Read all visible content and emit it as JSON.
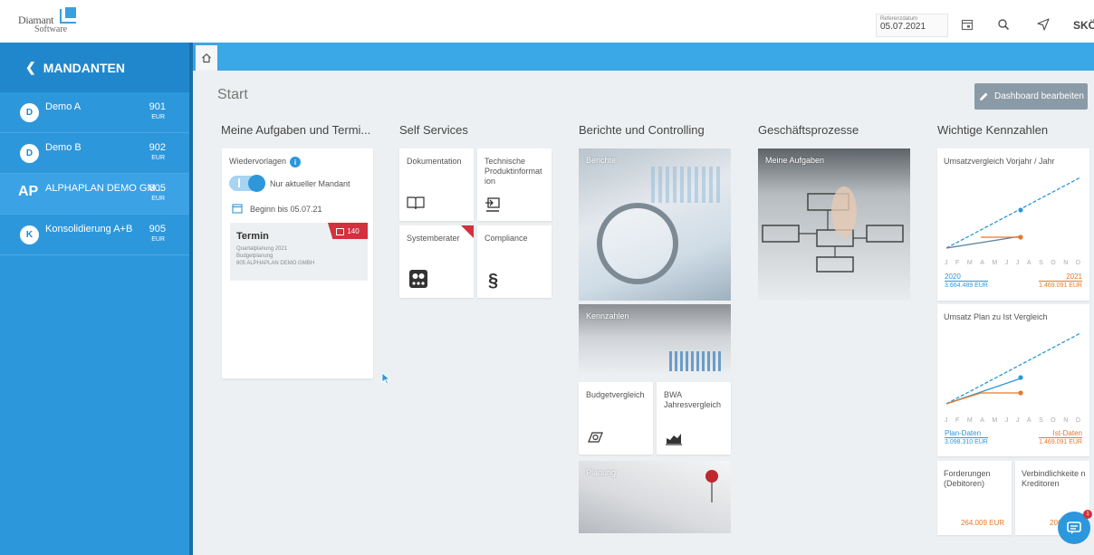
{
  "brand": {
    "line1": "Diamant",
    "line2": "Software"
  },
  "topbar": {
    "refdate_label": "Referenzdatum",
    "refdate_value": "05.07.2021",
    "user": "SKÖ"
  },
  "sidebar": {
    "header": "MANDANTEN",
    "items": [
      {
        "avatar": "D",
        "name": "Demo A",
        "number": "901",
        "currency": "EUR"
      },
      {
        "avatar": "D",
        "name": "Demo B",
        "number": "902",
        "currency": "EUR"
      },
      {
        "avatar": "AP",
        "name": "ALPHAPLAN DEMO GM...",
        "number": "805",
        "currency": "EUR"
      },
      {
        "avatar": "K",
        "name": "Konsolidierung A+B",
        "number": "905",
        "currency": "EUR"
      }
    ]
  },
  "main": {
    "title": "Start",
    "edit_button": "Dashboard bearbeiten",
    "columns": {
      "aufgaben": "Meine Aufgaben und Termi...",
      "self_services": "Self Services",
      "berichte": "Berichte und Controlling",
      "prozesse": "Geschäftsprozesse",
      "kennzahlen": "Wichtige Kennzahlen"
    }
  },
  "aufgaben": {
    "wiedervorlagen": "Wiedervorlagen",
    "toggle_label": "Nur aktueller Mandant",
    "beginn": "Beginn bis 05.07.21",
    "termin": {
      "title": "Termin",
      "badge": "140",
      "lines": [
        "Quartalplanung 2021",
        "Budgetplanung",
        "805 ALPHAPLAN DEMO GMBH"
      ]
    }
  },
  "self_services": {
    "dokumentation": "Dokumentation",
    "technische": "Technische Produktinformat ion",
    "systemberater": "Systemberater",
    "compliance": "Compliance"
  },
  "berichte": {
    "berichte": "Berichte",
    "kennzahlen": "Kennzahlen",
    "budgetvergleich": "Budgetvergleich",
    "bwa": "BWA Jahresvergleich",
    "planung": "Planung"
  },
  "prozesse": {
    "aufgaben": "Meine Aufgaben"
  },
  "kennzahlen": {
    "months": [
      "J",
      "F",
      "M",
      "A",
      "M",
      "J",
      "J",
      "A",
      "S",
      "O",
      "N",
      "D"
    ],
    "umsatz_jahr": {
      "title": "Umsatzvergleich Vorjahr / Jahr",
      "left_label": "2020",
      "left_value": "3.664.489 EUR",
      "right_label": "2021",
      "right_value": "1.469.091 EUR"
    },
    "umsatz_plan": {
      "title": "Umsatz Plan zu Ist Vergleich",
      "left_label": "Plan-Daten",
      "left_value": "3.098.310 EUR",
      "right_label": "Ist-Daten",
      "right_value": "1.469.091 EUR"
    },
    "forderungen": {
      "title": "Forderungen (Debitoren)",
      "value": "264.009 EUR"
    },
    "verbindlichkeiten": {
      "title": "Verbindlichkeite n Kreditoren",
      "value": "206"
    }
  },
  "colors": {
    "primary": "#2d97db",
    "orange": "#e8772b",
    "red": "#d2313d"
  }
}
